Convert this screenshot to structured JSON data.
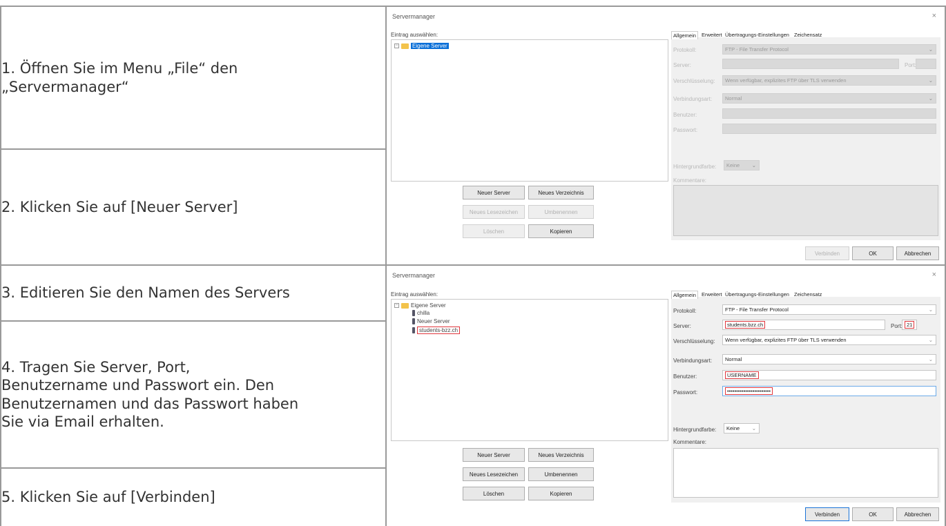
{
  "steps": [
    {
      "lines": [
        "1. Öffnen Sie im Menu „File“ den",
        "„Servermanager“"
      ]
    },
    {
      "lines": [
        "2. Klicken Sie auf [Neuer Server]"
      ]
    },
    {
      "lines": [
        "3. Editieren Sie den Namen des Servers"
      ]
    },
    {
      "lines": [
        "4. Tragen Sie Server, Port,",
        "Benutzername und Passwort ein. Den",
        "Benutzernamen und das Passwort haben",
        "Sie via Email erhalten."
      ]
    },
    {
      "lines": [
        "5. Klicken Sie auf [Verbinden]"
      ]
    }
  ],
  "dialog": {
    "title": "Servermanager",
    "close": "×",
    "select_entry_label": "Eintrag auswählen:",
    "tabs": [
      "Allgemein",
      "Erweitert",
      "Übertragungs-Einstellungen",
      "Zeichensatz"
    ],
    "labels": {
      "protocol": "Protokoll:",
      "server": "Server:",
      "port": "Port:",
      "encryption": "Verschlüsselung:",
      "logon_type": "Verbindungsart:",
      "user": "Benutzer:",
      "password": "Passwort:",
      "bg_color": "Hintergrundfarbe:",
      "comments": "Kommentare:"
    },
    "values": {
      "protocol": "FTP - File Transfer Protocol",
      "encryption": "Wenn verfügbar, explizites FTP über TLS verwenden",
      "logon_type": "Normal",
      "bg_color": "Keine"
    },
    "buttons": {
      "new_server": "Neuer Server",
      "new_folder": "Neues Verzeichnis",
      "new_bookmark": "Neues Lesezeichen",
      "rename": "Umbenennen",
      "delete": "Löschen",
      "copy": "Kopieren",
      "connect": "Verbinden",
      "ok": "OK",
      "cancel": "Abbrechen"
    }
  },
  "shot1": {
    "tree": [
      "Eigene Server"
    ]
  },
  "shot2": {
    "tree": [
      "Eigene Server",
      "chilla",
      "Neuer Server",
      "students-bzz.ch"
    ],
    "server": "students.bzz.ch",
    "port": "21",
    "user": "USERNAME",
    "password": "••••••••••••••••••••••••"
  },
  "colors": {
    "border": "#999999",
    "text": "#333333",
    "highlight": "#e0353b",
    "selection": "#0a6fd8",
    "folder": "#f3c34b"
  }
}
